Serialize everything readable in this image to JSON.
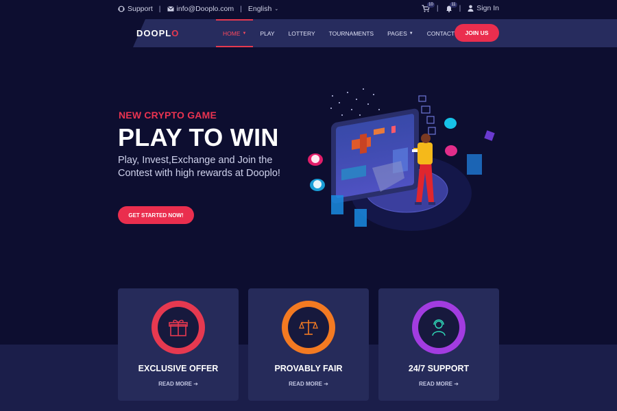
{
  "topbar": {
    "support": "Support",
    "email": "info@Dooplo.com",
    "language": "English",
    "cart_count": "10",
    "notif_count": "11",
    "signin": "Sign In"
  },
  "nav": {
    "logo_text": "DOOPL",
    "logo_accent": "O",
    "items": [
      {
        "label": "HOME"
      },
      {
        "label": "PLAY"
      },
      {
        "label": "LOTTERY"
      },
      {
        "label": "TOURNAMENTS"
      },
      {
        "label": "PAGES"
      },
      {
        "label": "CONTACT"
      }
    ],
    "join": "JOIN US"
  },
  "hero": {
    "eyebrow": "NEW CRYPTO GAME",
    "headline": "PLAY TO WIN",
    "description": "Play, Invest,Exchange and Join the Contest with high rewards at Dooplo!",
    "cta": "GET STARTED NOW!"
  },
  "features": [
    {
      "title": "EXCLUSIVE OFFER",
      "more": "READ MORE ➔",
      "icon": "gift-icon",
      "ring": "#e63950"
    },
    {
      "title": "PROVABLY FAIR",
      "more": "READ MORE ➔",
      "icon": "scale-icon",
      "ring": "#f37a22"
    },
    {
      "title": "24/7 SUPPORT",
      "more": "READ MORE ➔",
      "icon": "headset-icon",
      "ring": "#a23ce0"
    }
  ],
  "colors": {
    "accent": "#ea2e4e",
    "bg": "#0d0e30",
    "nav": "#272c5e",
    "card": "#262b5a"
  }
}
